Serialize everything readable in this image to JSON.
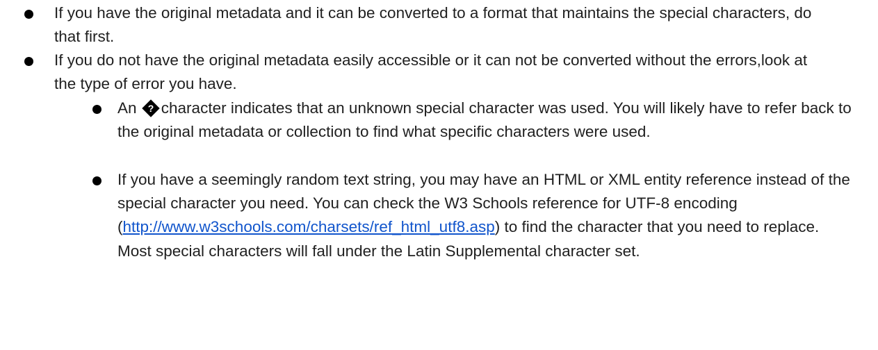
{
  "bullets": [
    {
      "text": "If you have the original metadata and it can be converted to a format that maintains the special characters, do that first."
    },
    {
      "text": "If you do not have the original metadata easily accessible or it can not be converted without the errors,look at the type of error you have."
    }
  ],
  "sub_bullets": [
    {
      "replacement_glyph_name": "replacement-character-icon",
      "text_before": "An ",
      "text_after": "character indicates that an unknown special character was used. You will likely have to refer back to the original metadata or collection to find what specific characters were used."
    },
    {
      "text_before": "If you have a seemingly random text string, you may have an HTML or XML entity reference instead of the special character you need. You can check the W3 Schools reference for UTF-8 encoding",
      "open_paren": "(",
      "link_text": "http://www.w3schools.com/charsets/ref_html_utf8.asp",
      "text_after": ") to find the character that you need to replace. Most special characters will fall under the Latin Supplemental character set."
    }
  ],
  "colors": {
    "text": "#1f1f1f",
    "bullet": "#000000",
    "link": "#1155cc",
    "background": "#ffffff"
  }
}
